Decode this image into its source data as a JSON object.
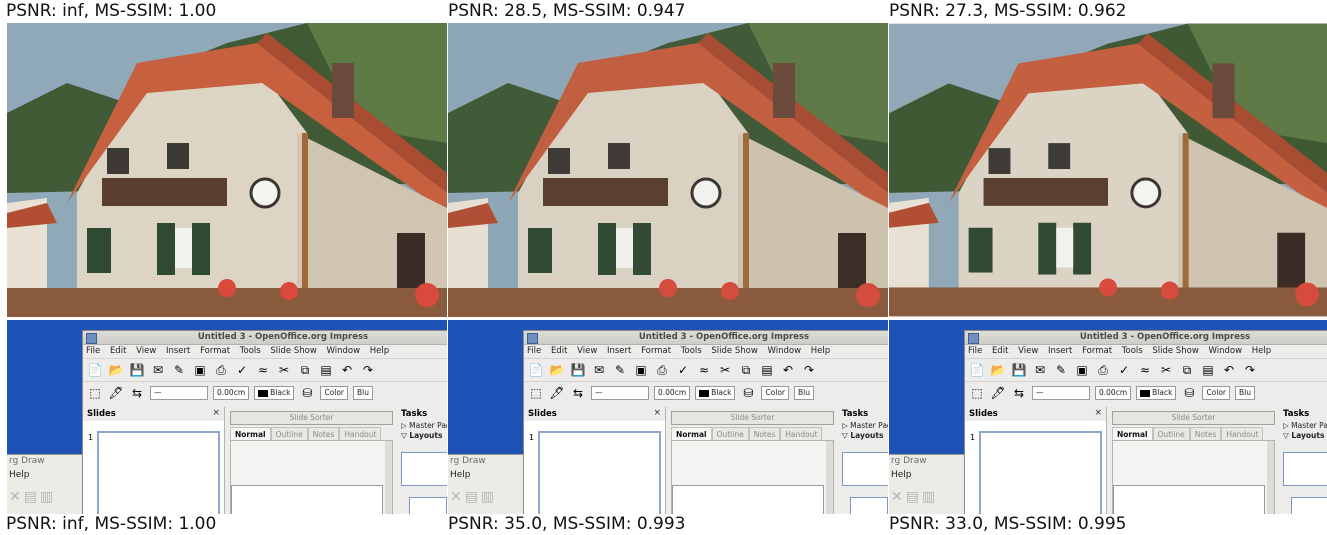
{
  "captions": {
    "top": [
      "PSNR: inf, MS-SSIM: 1.00",
      "PSNR: 28.5, MS-SSIM: 0.947",
      "PSNR: 27.3, MS-SSIM: 0.962"
    ],
    "bottom": [
      "PSNR: inf, MS-SSIM: 1.00",
      "PSNR: 35.0, MS-SSIM: 0.993",
      "PSNR: 33.0, MS-SSIM: 0.995"
    ]
  },
  "oo": {
    "title": "Untitled 3 - OpenOffice.org Impress",
    "menu": [
      "File",
      "Edit",
      "View",
      "Insert",
      "Format",
      "Tools",
      "Slide Show",
      "Window",
      "Help"
    ],
    "line_width": "0.00cm",
    "fill_color": "Black",
    "area_mode": "Color",
    "area_value": "Blu",
    "slides_label": "Slides",
    "close": "×",
    "slide_number": "1",
    "slide_sorter": "Slide Sorter",
    "tabs": [
      "Normal",
      "Outline",
      "Notes",
      "Handout"
    ],
    "tasks_label": "Tasks",
    "master_pages": "▷ Master Pag",
    "layouts": "▽ Layouts",
    "bg_window_title": "rg Draw",
    "bg_window_help": "Help"
  }
}
